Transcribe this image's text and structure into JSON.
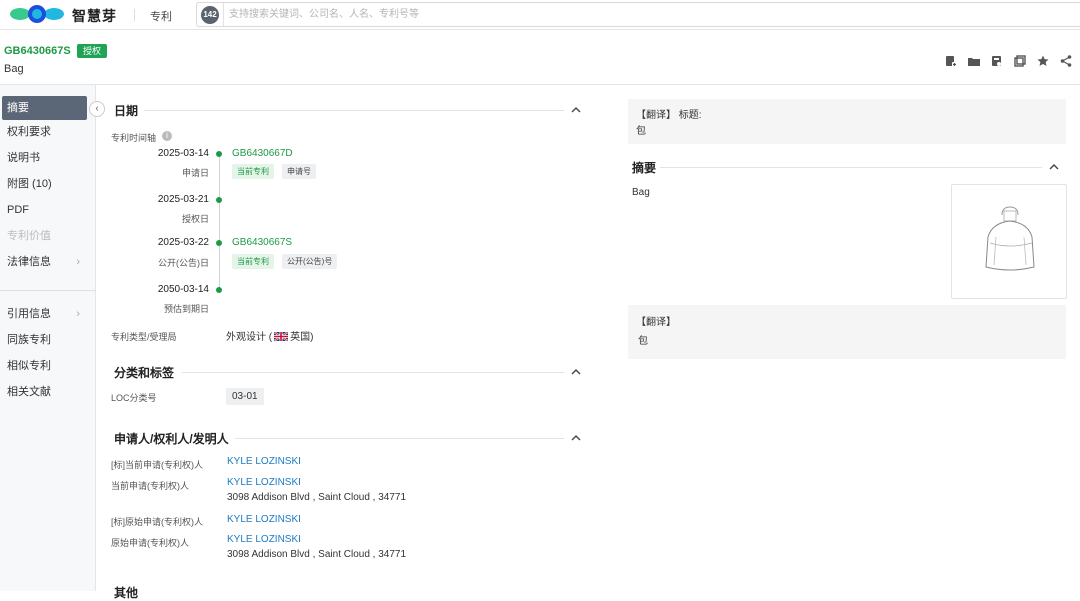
{
  "topbar": {
    "brand": "智慧芽",
    "nav_patent": "专利",
    "search_badge": "142",
    "search_placeholder": "支持搜索关键词、公司名、人名、专利号等"
  },
  "patent": {
    "number": "GB6430667S",
    "status": "授权",
    "title": "Bag"
  },
  "sidebar": {
    "items": [
      "摘要",
      "权利要求",
      "说明书",
      "附图 (10)",
      "PDF",
      "专利价值",
      "法律信息",
      "引用信息",
      "同族专利",
      "相似专利",
      "相关文献"
    ]
  },
  "dates": {
    "section_title": "日期",
    "timeline_label": "专利时间轴",
    "events": [
      {
        "date": "2025-03-14",
        "label": "申请日",
        "number": "GB6430667D",
        "tags": [
          "当前专利",
          "申请号"
        ]
      },
      {
        "date": "2025-03-21",
        "label": "授权日"
      },
      {
        "date": "2025-03-22",
        "label": "公开(公告)日",
        "number": "GB6430667S",
        "tags": [
          "当前专利",
          "公开(公告)号"
        ]
      },
      {
        "date": "2050-03-14",
        "label": "预估到期日"
      }
    ],
    "type_label": "专利类型/受理局",
    "type_value": "外观设计 (",
    "country": "英国)"
  },
  "classification": {
    "section_title": "分类和标签",
    "loc_label": "LOC分类号",
    "loc_value": "03-01"
  },
  "parties": {
    "section_title": "申请人/权利人/发明人",
    "rows": [
      {
        "label": "[标]当前申请(专利权)人",
        "name": "KYLE LOZINSKI"
      },
      {
        "label": "当前申请(专利权)人",
        "name": "KYLE LOZINSKI",
        "address": "3098 Addison Blvd , Saint Cloud , 34771"
      },
      {
        "label": "[标]原始申请(专利权)人",
        "name": "KYLE LOZINSKI"
      },
      {
        "label": "原始申请(专利权)人",
        "name": "KYLE LOZINSKI",
        "address": "3098 Addison Blvd , Saint Cloud , 34771"
      }
    ]
  },
  "other": {
    "section_title": "其他"
  },
  "right": {
    "title_translate_head": "【翻译】 标题:",
    "title_translate_body": "包",
    "abstract_title": "摘要",
    "abstract_text": "Bag",
    "abstract_translate_head": "【翻译】",
    "abstract_translate_body": "包"
  },
  "colors": {
    "accent_green": "#1d9a45",
    "link_blue": "#1b7bc4",
    "sidebar_active": "#5b6676"
  }
}
